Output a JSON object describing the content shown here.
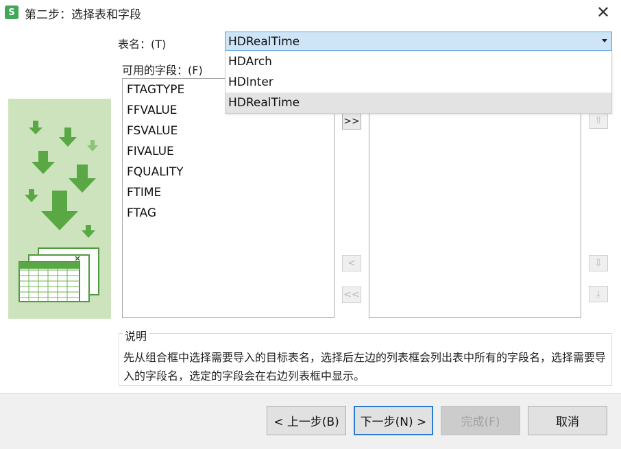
{
  "window": {
    "title": "第二步：选择表和字段",
    "app_icon": "S",
    "close_glyph": "✕"
  },
  "table_name": {
    "label": "表名：(T)",
    "value": "HDRealTime",
    "options": [
      "HDArch",
      "HDInter",
      "HDRealTime"
    ],
    "selected_option": "HDRealTime"
  },
  "available_fields": {
    "label": "可用的字段：(F)",
    "items": [
      "FTAGTYPE",
      "FFVALUE",
      "FSVALUE",
      "FIVALUE",
      "FQUALITY",
      "FTIME",
      "FTAG"
    ]
  },
  "move_buttons": {
    "add_all": ">>",
    "remove_one": "<",
    "remove_all": "<<"
  },
  "order_buttons": {
    "up": "⇧",
    "down": "⇩",
    "bottom": "⤓"
  },
  "description": {
    "title": "说明",
    "text": "先从组合框中选择需要导入的目标表名，选择后左边的列表框会列出表中所有的字段名，选择需要导入的字段名，选定的字段会在右边列表框中显示。"
  },
  "footer": {
    "back": "< 上一步(B)",
    "next": "下一步(N) >",
    "finish": "完成(F)",
    "cancel": "取消"
  },
  "colors": {
    "accent": "#2a7bd0",
    "combo_bg": "#cde5f7",
    "side_art_bg": "#cde3bd",
    "arrow_green": "#5aa845"
  }
}
